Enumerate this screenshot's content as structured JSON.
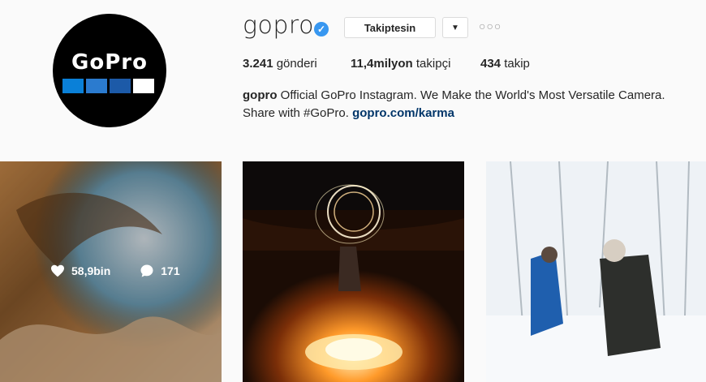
{
  "profile": {
    "username": "gopro",
    "avatar_logo_text": "GoPro",
    "avatar_square_colors": [
      "#0a80d8",
      "#2b7bcf",
      "#1c5aa8",
      "#ffffff"
    ],
    "follow_button_label": "Takiptesin",
    "verified_icon": "check-badge-icon",
    "stats": {
      "posts_count": "3.241",
      "posts_label": "gönderi",
      "followers_count": "11,4milyon",
      "followers_label": "takipçi",
      "following_count": "434",
      "following_label": "takip"
    },
    "bio": {
      "name": "gopro",
      "text": "Official GoPro Instagram. We Make the World's Most Versatile Camera. Share with #GoPro.",
      "link": "gopro.com/karma"
    }
  },
  "posts": [
    {
      "likes": "58,9bin",
      "comments": "171",
      "hovered": true
    },
    {
      "hovered": false
    },
    {
      "hovered": false
    }
  ],
  "colors": {
    "link": "#003569",
    "verified": "#3897f0",
    "background": "#fafafa"
  }
}
